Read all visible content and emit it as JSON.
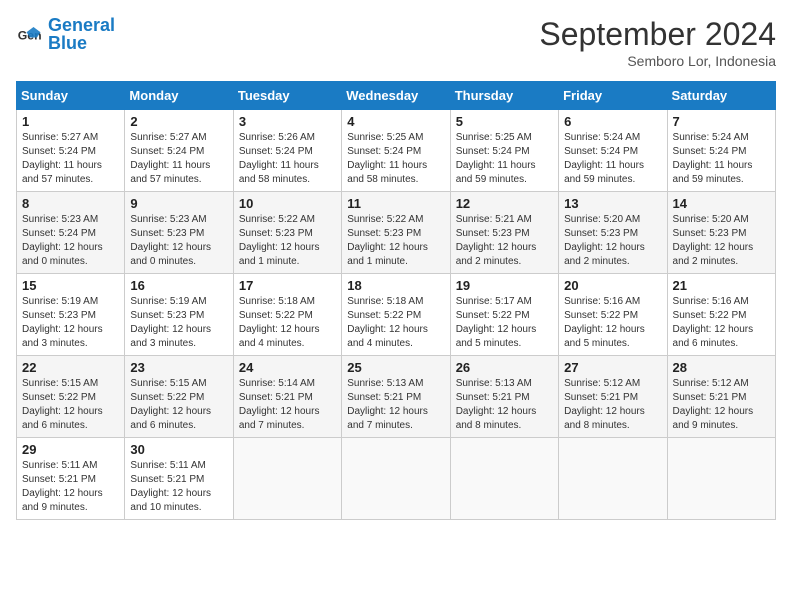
{
  "header": {
    "logo_text_general": "General",
    "logo_text_blue": "Blue",
    "month": "September 2024",
    "location": "Semboro Lor, Indonesia"
  },
  "weekdays": [
    "Sunday",
    "Monday",
    "Tuesday",
    "Wednesday",
    "Thursday",
    "Friday",
    "Saturday"
  ],
  "weeks": [
    [
      {
        "day": "1",
        "sunrise": "5:27 AM",
        "sunset": "5:24 PM",
        "daylight": "11 hours and 57 minutes."
      },
      {
        "day": "2",
        "sunrise": "5:27 AM",
        "sunset": "5:24 PM",
        "daylight": "11 hours and 57 minutes."
      },
      {
        "day": "3",
        "sunrise": "5:26 AM",
        "sunset": "5:24 PM",
        "daylight": "11 hours and 58 minutes."
      },
      {
        "day": "4",
        "sunrise": "5:25 AM",
        "sunset": "5:24 PM",
        "daylight": "11 hours and 58 minutes."
      },
      {
        "day": "5",
        "sunrise": "5:25 AM",
        "sunset": "5:24 PM",
        "daylight": "11 hours and 59 minutes."
      },
      {
        "day": "6",
        "sunrise": "5:24 AM",
        "sunset": "5:24 PM",
        "daylight": "11 hours and 59 minutes."
      },
      {
        "day": "7",
        "sunrise": "5:24 AM",
        "sunset": "5:24 PM",
        "daylight": "11 hours and 59 minutes."
      }
    ],
    [
      {
        "day": "8",
        "sunrise": "5:23 AM",
        "sunset": "5:24 PM",
        "daylight": "12 hours and 0 minutes."
      },
      {
        "day": "9",
        "sunrise": "5:23 AM",
        "sunset": "5:23 PM",
        "daylight": "12 hours and 0 minutes."
      },
      {
        "day": "10",
        "sunrise": "5:22 AM",
        "sunset": "5:23 PM",
        "daylight": "12 hours and 1 minute."
      },
      {
        "day": "11",
        "sunrise": "5:22 AM",
        "sunset": "5:23 PM",
        "daylight": "12 hours and 1 minute."
      },
      {
        "day": "12",
        "sunrise": "5:21 AM",
        "sunset": "5:23 PM",
        "daylight": "12 hours and 2 minutes."
      },
      {
        "day": "13",
        "sunrise": "5:20 AM",
        "sunset": "5:23 PM",
        "daylight": "12 hours and 2 minutes."
      },
      {
        "day": "14",
        "sunrise": "5:20 AM",
        "sunset": "5:23 PM",
        "daylight": "12 hours and 2 minutes."
      }
    ],
    [
      {
        "day": "15",
        "sunrise": "5:19 AM",
        "sunset": "5:23 PM",
        "daylight": "12 hours and 3 minutes."
      },
      {
        "day": "16",
        "sunrise": "5:19 AM",
        "sunset": "5:23 PM",
        "daylight": "12 hours and 3 minutes."
      },
      {
        "day": "17",
        "sunrise": "5:18 AM",
        "sunset": "5:22 PM",
        "daylight": "12 hours and 4 minutes."
      },
      {
        "day": "18",
        "sunrise": "5:18 AM",
        "sunset": "5:22 PM",
        "daylight": "12 hours and 4 minutes."
      },
      {
        "day": "19",
        "sunrise": "5:17 AM",
        "sunset": "5:22 PM",
        "daylight": "12 hours and 5 minutes."
      },
      {
        "day": "20",
        "sunrise": "5:16 AM",
        "sunset": "5:22 PM",
        "daylight": "12 hours and 5 minutes."
      },
      {
        "day": "21",
        "sunrise": "5:16 AM",
        "sunset": "5:22 PM",
        "daylight": "12 hours and 6 minutes."
      }
    ],
    [
      {
        "day": "22",
        "sunrise": "5:15 AM",
        "sunset": "5:22 PM",
        "daylight": "12 hours and 6 minutes."
      },
      {
        "day": "23",
        "sunrise": "5:15 AM",
        "sunset": "5:22 PM",
        "daylight": "12 hours and 6 minutes."
      },
      {
        "day": "24",
        "sunrise": "5:14 AM",
        "sunset": "5:21 PM",
        "daylight": "12 hours and 7 minutes."
      },
      {
        "day": "25",
        "sunrise": "5:13 AM",
        "sunset": "5:21 PM",
        "daylight": "12 hours and 7 minutes."
      },
      {
        "day": "26",
        "sunrise": "5:13 AM",
        "sunset": "5:21 PM",
        "daylight": "12 hours and 8 minutes."
      },
      {
        "day": "27",
        "sunrise": "5:12 AM",
        "sunset": "5:21 PM",
        "daylight": "12 hours and 8 minutes."
      },
      {
        "day": "28",
        "sunrise": "5:12 AM",
        "sunset": "5:21 PM",
        "daylight": "12 hours and 9 minutes."
      }
    ],
    [
      {
        "day": "29",
        "sunrise": "5:11 AM",
        "sunset": "5:21 PM",
        "daylight": "12 hours and 9 minutes."
      },
      {
        "day": "30",
        "sunrise": "5:11 AM",
        "sunset": "5:21 PM",
        "daylight": "12 hours and 10 minutes."
      },
      null,
      null,
      null,
      null,
      null
    ]
  ]
}
